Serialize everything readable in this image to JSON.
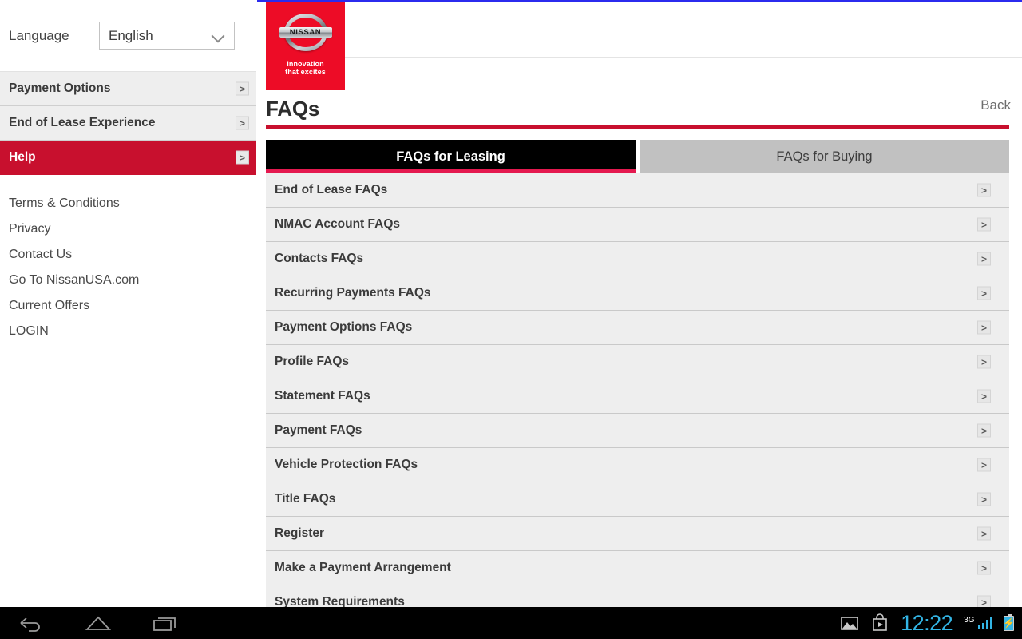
{
  "sidebar": {
    "language": {
      "label": "Language",
      "selected": "English",
      "icon": "chevron-down-icon"
    },
    "accordion": [
      {
        "label": "Payment Options",
        "active": false,
        "arrow": ">"
      },
      {
        "label": "End of Lease Experience",
        "active": false,
        "arrow": ">"
      },
      {
        "label": "Help",
        "active": true,
        "arrow": ">"
      }
    ],
    "links": [
      "Terms & Conditions",
      "Privacy",
      "Contact Us",
      "Go To NissanUSA.com",
      "Current Offers",
      "LOGIN"
    ]
  },
  "brand": {
    "name": "NISSAN",
    "tagline_line1": "Innovation",
    "tagline_line2": "that excites",
    "red": "#ed0c26"
  },
  "main": {
    "title": "FAQs",
    "back_label": "Back",
    "accent": "#c8102e",
    "tabs": [
      {
        "label": "FAQs for Leasing",
        "active": true
      },
      {
        "label": "FAQs for Buying",
        "active": false
      }
    ],
    "faq_items": [
      {
        "label": "End of Lease FAQs",
        "arrow": ">"
      },
      {
        "label": "NMAC Account FAQs",
        "arrow": ">"
      },
      {
        "label": "Contacts FAQs",
        "arrow": ">"
      },
      {
        "label": "Recurring Payments FAQs",
        "arrow": ">"
      },
      {
        "label": "Payment Options FAQs",
        "arrow": ">"
      },
      {
        "label": "Profile FAQs",
        "arrow": ">"
      },
      {
        "label": "Statement FAQs",
        "arrow": ">"
      },
      {
        "label": "Payment FAQs",
        "arrow": ">"
      },
      {
        "label": "Vehicle Protection FAQs",
        "arrow": ">"
      },
      {
        "label": "Title FAQs",
        "arrow": ">"
      },
      {
        "label": "Register",
        "arrow": ">"
      },
      {
        "label": "Make a Payment Arrangement",
        "arrow": ">"
      },
      {
        "label": "System Requirements",
        "arrow": ">"
      }
    ]
  },
  "system_bar": {
    "nav_keys": [
      "back-icon",
      "home-icon",
      "recents-icon"
    ],
    "status_icons": [
      "screenshot-icon",
      "play-store-icon"
    ],
    "clock": "12:22",
    "network_type": "3G",
    "signal_bars": 4,
    "battery": "charging"
  }
}
